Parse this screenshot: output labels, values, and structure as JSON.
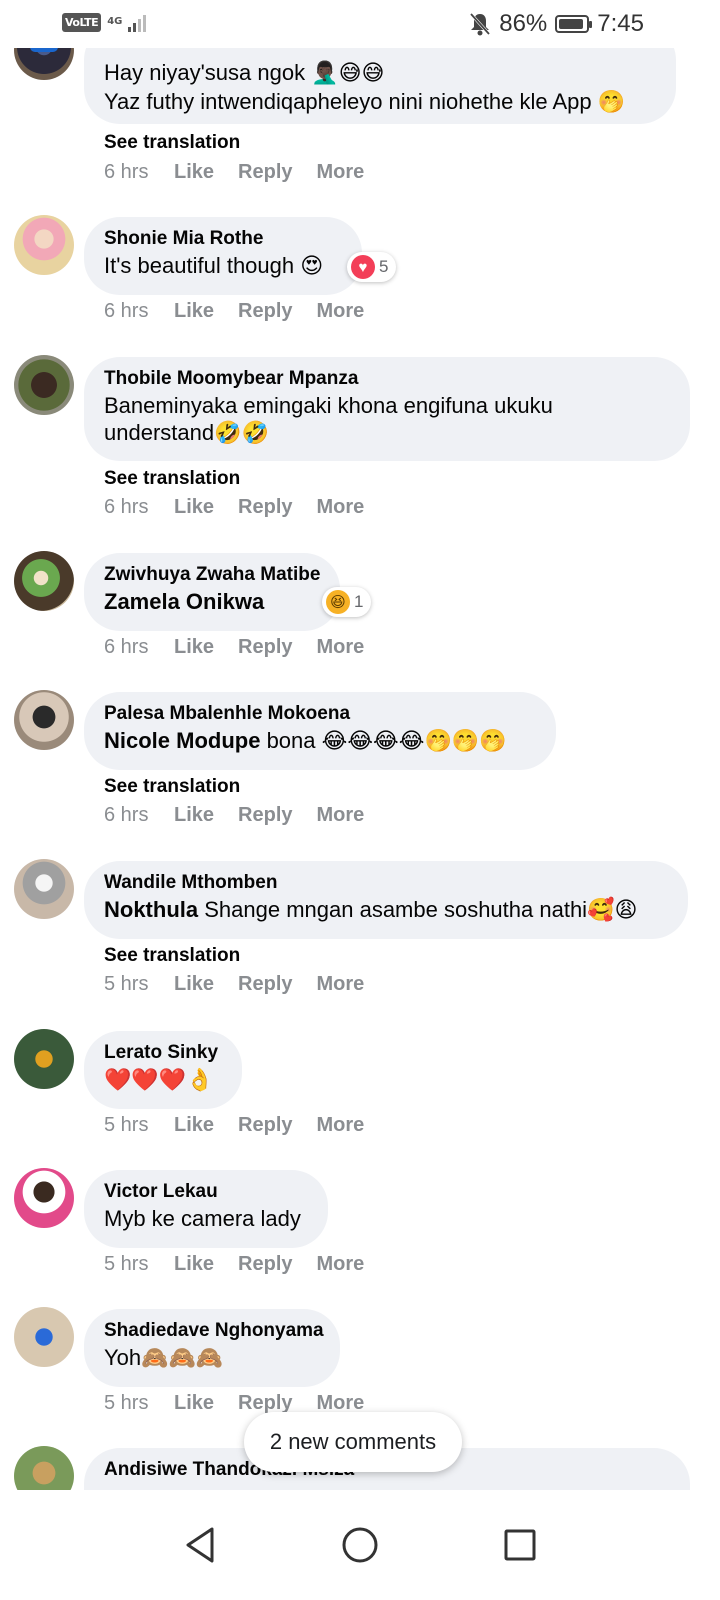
{
  "status_bar": {
    "volte": "VoLTE",
    "network": "4G",
    "signal_level": 0.5,
    "battery": "86%",
    "time": "7:45",
    "icons": [
      "bell-off-icon",
      "battery-saver-icon"
    ]
  },
  "comments": [
    {
      "author": "",
      "lines": [
        "Hay niyay'susa ngok 🤦🏿‍♂️😅😅",
        "Yaz futhy intwendiqapheleyo nini niohethe kle App 🤭"
      ],
      "see_translation": "See translation",
      "time": "6 hrs",
      "like": "Like",
      "reply": "Reply",
      "more": "More"
    },
    {
      "author": "Shonie Mia Rothe",
      "lines": [
        "It's beautiful though 😍"
      ],
      "reaction": {
        "icon": "heart-reaction-icon",
        "count": "5"
      },
      "time": "6 hrs",
      "like": "Like",
      "reply": "Reply",
      "more": "More"
    },
    {
      "author": "Thobile Moomybear Mpanza",
      "lines": [
        "Baneminyaka emingaki khona engifuna ukuku",
        "understand🤣🤣"
      ],
      "see_translation": "See translation",
      "time": "6 hrs",
      "like": "Like",
      "reply": "Reply",
      "more": "More"
    },
    {
      "author": "Zwivhuya Zwaha Matibe",
      "mention": "Zamela Onikwa",
      "lines": [
        ""
      ],
      "reaction": {
        "icon": "haha-reaction-icon",
        "count": "1"
      },
      "time": "6 hrs",
      "like": "Like",
      "reply": "Reply",
      "more": "More"
    },
    {
      "author": "Palesa Mbalenhle Mokoena",
      "mention": "Nicole Modupe",
      "lines": [
        " bona 😂😂😂😂🤭🤭🤭"
      ],
      "see_translation": "See translation",
      "time": "6 hrs",
      "like": "Like",
      "reply": "Reply",
      "more": "More"
    },
    {
      "author": "Wandile Mthomben",
      "mention": "Nokthula",
      "lines": [
        " Shange mngan asambe soshutha nathi🥰😩"
      ],
      "see_translation": "See translation",
      "time": "5 hrs",
      "like": "Like",
      "reply": "Reply",
      "more": "More"
    },
    {
      "author": "Lerato Sinky",
      "lines": [
        "❤️❤️❤️👌"
      ],
      "time": "5 hrs",
      "like": "Like",
      "reply": "Reply",
      "more": "More"
    },
    {
      "author": "Victor Lekau",
      "lines": [
        "Myb ke camera lady"
      ],
      "time": "5 hrs",
      "like": "Like",
      "reply": "Reply",
      "more": "More"
    },
    {
      "author": "Shadiedave Nghonyama",
      "lines": [
        "Yoh🙈🙈🙈"
      ],
      "time": "5 hrs",
      "like": "Like",
      "reply": "Reply",
      "more": "More"
    },
    {
      "author": "Andisiwe Thandokazi Msiza"
    }
  ],
  "new_comments_pill": "2 new comments",
  "nav": [
    "back-icon",
    "home-icon",
    "recents-icon"
  ]
}
